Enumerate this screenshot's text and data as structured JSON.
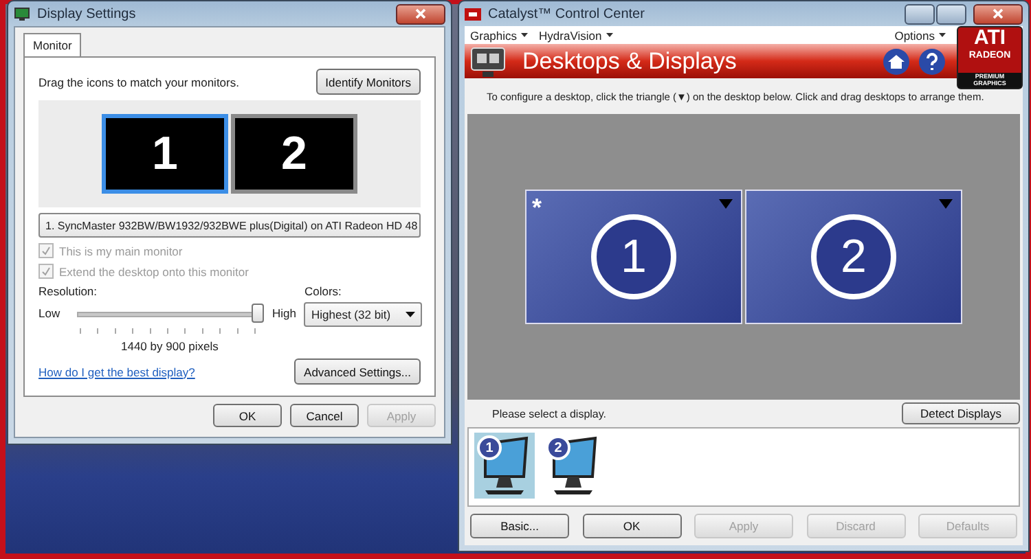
{
  "display_settings": {
    "title": "Display Settings",
    "tabs": [
      {
        "label": "Monitor",
        "selected": true
      }
    ],
    "instruction": "Drag the icons to match your monitors.",
    "identify_button": "Identify Monitors",
    "monitors": [
      {
        "label": "1",
        "selected": true
      },
      {
        "label": "2",
        "selected": false
      }
    ],
    "monitor_select": "1. SyncMaster 932BW/BW1932/932BWE plus(Digital) on ATI Radeon HD 48",
    "checkboxes": [
      {
        "label": "This is my main monitor",
        "checked": true,
        "disabled": true
      },
      {
        "label": "Extend the desktop onto this monitor",
        "checked": true,
        "disabled": true
      }
    ],
    "resolution": {
      "label": "Resolution:",
      "low": "Low",
      "high": "High",
      "level": 1.0,
      "reading": "1440 by 900 pixels"
    },
    "colors": {
      "label": "Colors:",
      "value": "Highest (32 bit)"
    },
    "help_link": "How do I get the best display?",
    "advanced_button": "Advanced Settings...",
    "buttons": [
      {
        "label": "OK",
        "disabled": false
      },
      {
        "label": "Cancel",
        "disabled": false
      },
      {
        "label": "Apply",
        "disabled": true
      }
    ]
  },
  "catalyst": {
    "title": "Catalyst™ Control Center",
    "menus": [
      "Graphics",
      "HydraVision"
    ],
    "options_menu": "Options",
    "logo": {
      "brand": "ATI",
      "line_1": "RADEON",
      "line_2": "PREMIUM",
      "line_3": "GRAPHICS"
    },
    "header": "Desktops & Displays",
    "instruction": "To configure a desktop, click the triangle (▼) on the desktop below.  Click and drag desktops to arrange them.",
    "desktops": [
      {
        "label": "1",
        "primary_mark": "*"
      },
      {
        "label": "2"
      }
    ],
    "status": "Please select a display.",
    "detect_button": "Detect Displays",
    "displays": [
      {
        "label": "1",
        "selected": true
      },
      {
        "label": "2",
        "selected": false
      }
    ],
    "buttons": [
      {
        "label": "Basic...",
        "disabled": false
      },
      {
        "label": "OK",
        "disabled": false
      },
      {
        "label": "Apply",
        "disabled": true
      },
      {
        "label": "Discard",
        "disabled": true
      },
      {
        "label": "Defaults",
        "disabled": true
      }
    ]
  }
}
